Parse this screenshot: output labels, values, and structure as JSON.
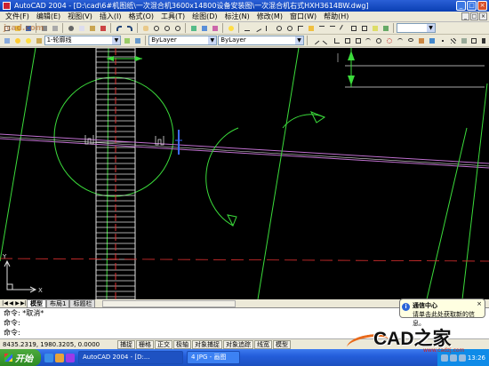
{
  "window": {
    "title": "AutoCAD 2004 - [D:\\cad\\6#机图纸\\一次混合机3600x14800设备安装图\\一次混合机右式HXH3614BW.dwg]",
    "controls": [
      "_",
      "□",
      "×"
    ]
  },
  "watermark_top": "jcad.com",
  "menu": {
    "items": [
      "文件(F)",
      "编辑(E)",
      "视图(V)",
      "插入(I)",
      "格式(O)",
      "工具(T)",
      "绘图(D)",
      "标注(N)",
      "修改(M)",
      "窗口(W)",
      "帮助(H)"
    ],
    "doc_controls": [
      "_",
      "□",
      "×"
    ]
  },
  "toolbar2": {
    "layer_value": "1-轮廓线",
    "color_value": "ByLayer",
    "linetype_value": "ByLayer"
  },
  "layout_tabs": [
    "模型",
    "布局1",
    "标题栏"
  ],
  "command": {
    "lines": [
      "命令: *取消*",
      "命令:",
      "命令:"
    ]
  },
  "status": {
    "coords": "8435.2319, 1980.3205, 0.0000",
    "toggles": [
      "捕捉",
      "栅格",
      "正交",
      "极轴",
      "对象捕捉",
      "对象追踪",
      "线宽",
      "模型"
    ]
  },
  "balloon": {
    "title": "通信中心",
    "text": "请单击此处获取新的信息。"
  },
  "taskbar": {
    "start_label": "开始",
    "tasks": [
      "AutoCAD 2004 - [D:...",
      "4 JPG - 画图"
    ],
    "clock": "13:26"
  },
  "logo": {
    "text": "CAD之家",
    "site": "www.cadzj.com"
  },
  "colors": {
    "canvas_bg": "#000000",
    "green_lines": "#3bdc3b",
    "magenta_lines": "#c070d0",
    "red_lines": "#e03030",
    "white_lines": "#e0e0e0",
    "blue_marker": "#3a6cff"
  }
}
